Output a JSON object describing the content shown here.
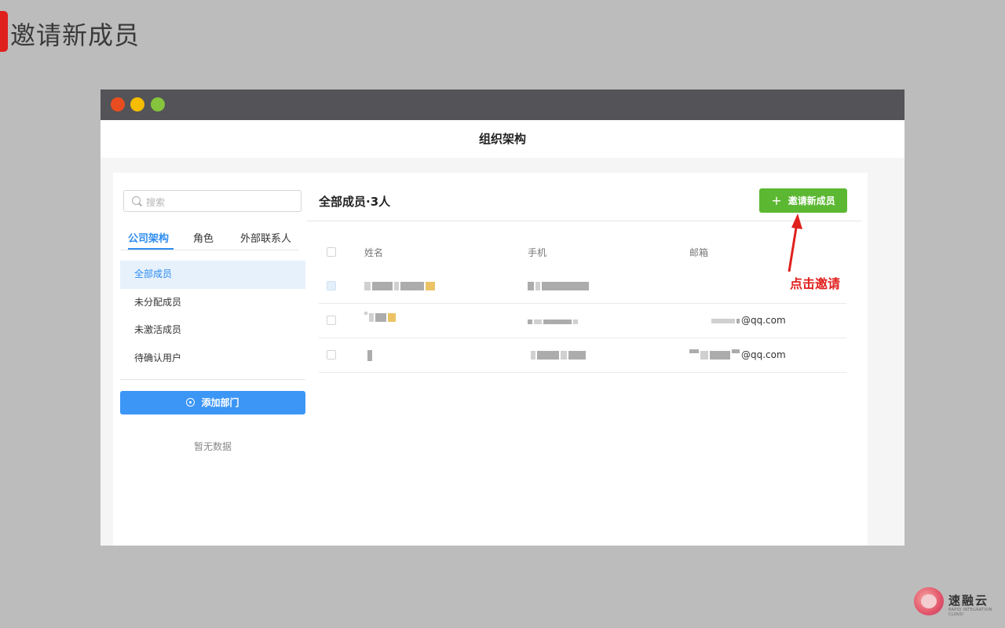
{
  "slide": {
    "title": "邀请新成员",
    "annotation": "点击邀请"
  },
  "window": {
    "header_title": "组织架构"
  },
  "sidebar": {
    "search_placeholder": "搜索",
    "tabs": [
      {
        "label": "公司架构",
        "active": true
      },
      {
        "label": "角色",
        "active": false
      },
      {
        "label": "外部联系人",
        "active": false
      }
    ],
    "menu": [
      {
        "label": "全部成员",
        "active": true
      },
      {
        "label": "未分配成员",
        "active": false
      },
      {
        "label": "未激活成员",
        "active": false
      },
      {
        "label": "待确认用户",
        "active": false
      }
    ],
    "add_dept_label": "添加部门",
    "empty_text": "暂无数据"
  },
  "main": {
    "title": "全部成员·3人",
    "invite_label": "邀请新成员",
    "columns": {
      "name": "姓名",
      "phone": "手机",
      "email": "邮箱"
    },
    "rows": [
      {
        "email_suffix": ""
      },
      {
        "email_suffix": "@qq.com"
      },
      {
        "email_suffix": "@qq.com"
      }
    ]
  },
  "logo": {
    "name": "速融云",
    "sub": "RAPID INTEGRATION CLOUD"
  },
  "colors": {
    "accent_blue": "#2d8cf0",
    "invite_green": "#5cb832",
    "annotation_red": "#e0201d",
    "titlebar": "#545357"
  }
}
